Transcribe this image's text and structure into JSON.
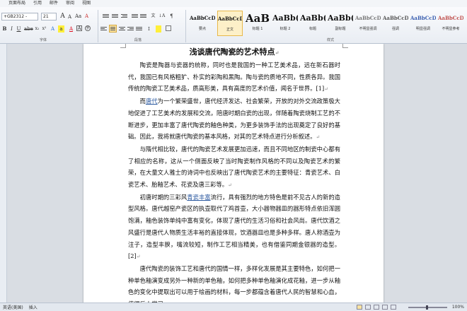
{
  "menu": [
    "页面布局",
    "引用",
    "邮件",
    "审阅",
    "视图"
  ],
  "font": {
    "name": "+GB2312 -",
    "size": "21"
  },
  "groups": {
    "font": "字体",
    "paragraph": "段落",
    "styles": "样式"
  },
  "styles": [
    {
      "preview": "AaBbCcD",
      "name": "要点",
      "size": 7,
      "color": "#111"
    },
    {
      "preview": "AaBbCcD",
      "name": "正文",
      "size": 7,
      "color": "#111",
      "selected": true
    },
    {
      "preview": "AaB",
      "name": "标题 1",
      "size": 15,
      "color": "#111"
    },
    {
      "preview": "AaBb(",
      "name": "标题 2",
      "size": 11,
      "color": "#111"
    },
    {
      "preview": "AaBb(",
      "name": "标题",
      "size": 11,
      "color": "#111"
    },
    {
      "preview": "AaBb(",
      "name": "副标题",
      "size": 11,
      "color": "#111"
    },
    {
      "preview": "AaBbCcD",
      "name": "不明显强调",
      "size": 7,
      "color": "#777"
    },
    {
      "preview": "AaBbCcD",
      "name": "强调",
      "size": 7,
      "color": "#555"
    },
    {
      "preview": "AaBbCcD",
      "name": "明显强调",
      "size": 7,
      "color": "#3a5fb0"
    },
    {
      "preview": "AaBbCcD",
      "name": "不明显参考",
      "size": 7,
      "color": "#c0504d"
    }
  ],
  "document": {
    "title": "浅谈唐代陶瓷的艺术特点",
    "p1": "陶瓷是陶器与瓷器的统称，同时也是我国的一种工艺美术品，远在新石器时代，我国已有风格粗犷、朴实的彩陶和黑陶。陶与瓷的质地不同，性质各异。我国传统的陶瓷工艺美术品，质高形美，具有高度的艺术价值，闻名于世界。[1]",
    "p2a": "而",
    "p2link": "唐代",
    "p2b": "为一个繁荣盛世，唐代经济发达、社会繁荣，开放的对外交流政策极大地促进了工艺美术的发展和交流，陪唐时期白瓷的出现，伴随着陶瓷烧制工艺的不断进步，更加丰富了唐代陶瓷的釉色种类，为更多装饰手法的出现奠定了良好的基础。因此，我将就唐代陶瓷的基本风格，对其的艺术特点进行分析叙述。",
    "p3": "与隋代相比较，唐代的陶瓷艺术发展更加迅速，而且不同地区的制瓷中心都有了相应的名称，这从一个侧面反映了当时陶瓷制作风格的不同以及陶瓷艺术的繁荣，在大量文人雅士的诗词中也反映出了唐代陶瓷艺术的主要特征：青瓷艺术、白瓷艺术、胎釉艺术、花瓷及唐三彩等。",
    "p4a": "初唐时期的三彩风",
    "p4link": "青瓷丰富",
    "p4b": "流行，具有强烈的地方特色是前不见古人的新的造型风格。唐代越窑产瓷区的执壶取代了鸡首壶，大小器物器皿的器形特点依旧浑圆饱满，釉色装饰单纯中富有变化，体现了唐代的生活习俗和社会风尚。唐代饮酒之风盛行是唐代人物质生活丰裕的直接体现，饮酒器皿也是多种多样。唐人称酒壶为注子，造型丰腴，嘴流较短，制作工艺相当精美，也有借鉴同期金银器的造型。[2]",
    "p5": "唐代陶瓷的装饰工艺和唐代的国情一样，多样化发展是其主要特色，如何把一种单色釉演变成另外一种新的单色釉，如何把多种单色釉演化成花釉，进一步从釉色的变化中提取出可以用于绘画的材料，每一步都蕴含着唐代人民的智慧和心血，值得后人学习。"
  },
  "status": {
    "lang": "英语(美国)",
    "mode": "插入",
    "zoom": "100%"
  }
}
